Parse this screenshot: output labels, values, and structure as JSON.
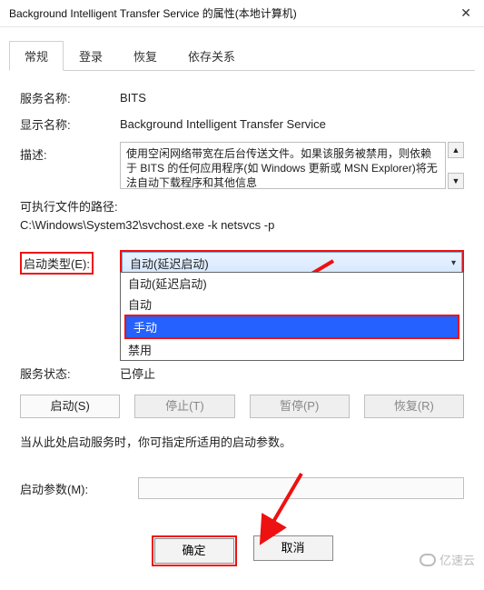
{
  "title": "Background Intelligent Transfer Service 的属性(本地计算机)",
  "tabs": {
    "t0": "常规",
    "t1": "登录",
    "t2": "恢复",
    "t3": "依存关系"
  },
  "labels": {
    "service_name": "服务名称:",
    "display_name": "显示名称:",
    "description": "描述:",
    "exe_path": "可执行文件的路径:",
    "startup_type": "启动类型(E):",
    "service_status": "服务状态:",
    "startup_params": "启动参数(M):",
    "hint": "当从此处启动服务时，你可指定所适用的启动参数。"
  },
  "values": {
    "service_name": "BITS",
    "display_name": "Background Intelligent Transfer Service",
    "description": "使用空闲网络带宽在后台传送文件。如果该服务被禁用，则依赖于 BITS 的任何应用程序(如 Windows 更新或 MSN Explorer)将无法自动下载程序和其他信息",
    "exe_path": "C:\\Windows\\System32\\svchost.exe -k netsvcs -p",
    "startup_selected": "自动(延迟启动)",
    "service_status": "已停止",
    "startup_params": ""
  },
  "startup_options": {
    "o0": "自动(延迟启动)",
    "o1": "自动",
    "o2": "手动",
    "o3": "禁用"
  },
  "buttons": {
    "start": "启动(S)",
    "stop": "停止(T)",
    "pause": "暂停(P)",
    "resume": "恢复(R)",
    "ok": "确定",
    "cancel": "取消"
  },
  "watermark": "亿速云"
}
